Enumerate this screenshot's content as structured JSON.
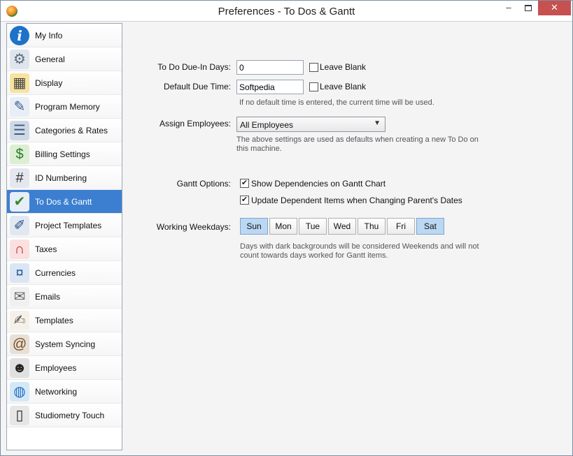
{
  "window": {
    "title": "Preferences - To Dos & Gantt",
    "minimize_symbol": "–",
    "close_symbol": "✕"
  },
  "sidebar": {
    "items": [
      {
        "label": "My Info",
        "icon": "info-icon",
        "glyph": "i",
        "bg": "#1e72c9",
        "fg": "#ffffff"
      },
      {
        "label": "General",
        "icon": "gear-icon",
        "glyph": "⚙",
        "bg": "#dfe5ec",
        "fg": "#5a6a7e"
      },
      {
        "label": "Display",
        "icon": "monitor-icon",
        "glyph": "▦",
        "bg": "#f7e3a0",
        "fg": "#444444"
      },
      {
        "label": "Program Memory",
        "icon": "memory-pencil-icon",
        "glyph": "✎",
        "bg": "#e7eef6",
        "fg": "#3a5a8a"
      },
      {
        "label": "Categories & Rates",
        "icon": "categories-icon",
        "glyph": "☰",
        "bg": "#cfd9e6",
        "fg": "#3c5b85"
      },
      {
        "label": "Billing Settings",
        "icon": "billing-dollar-icon",
        "glyph": "$",
        "bg": "#dcefd4",
        "fg": "#2b7a2b"
      },
      {
        "label": "ID Numbering",
        "icon": "id-numbering-icon",
        "glyph": "#",
        "bg": "#e4e8ee",
        "fg": "#333333"
      },
      {
        "label": "To Dos & Gantt",
        "icon": "todo-gantt-icon",
        "glyph": "✔",
        "bg": "#e8eef8",
        "fg": "#3a8a2a"
      },
      {
        "label": "Project Templates",
        "icon": "project-templates-icon",
        "glyph": "✐",
        "bg": "#e2e8f2",
        "fg": "#2a4d80"
      },
      {
        "label": "Taxes",
        "icon": "tax-magnet-icon",
        "glyph": "∩",
        "bg": "#fbe0e0",
        "fg": "#c02020"
      },
      {
        "label": "Currencies",
        "icon": "currency-icon",
        "glyph": "¤",
        "bg": "#dbe6f4",
        "fg": "#2a5a9a"
      },
      {
        "label": "Emails",
        "icon": "email-icon",
        "glyph": "✉",
        "bg": "#f0f0f0",
        "fg": "#666666"
      },
      {
        "label": "Templates",
        "icon": "templates-icon",
        "glyph": "✍",
        "bg": "#f5f1e8",
        "fg": "#555555"
      },
      {
        "label": "System Syncing",
        "icon": "sync-icon",
        "glyph": "@",
        "bg": "#e6e0d6",
        "fg": "#7a4a20"
      },
      {
        "label": "Employees",
        "icon": "employees-icon",
        "glyph": "☻",
        "bg": "#e0e0e0",
        "fg": "#222222"
      },
      {
        "label": "Networking",
        "icon": "globe-icon",
        "glyph": "◍",
        "bg": "#d5e8f7",
        "fg": "#1c6cc0"
      },
      {
        "label": "Studiometry Touch",
        "icon": "phone-icon",
        "glyph": "▯",
        "bg": "#e6e6e6",
        "fg": "#222222"
      }
    ]
  },
  "todo": {
    "due_days_label": "To Do Due-In Days:",
    "due_days_value": "0",
    "due_days_blank_label": "Leave Blank",
    "due_time_label": "Default Due Time:",
    "due_time_value": "Softpedia",
    "due_time_blank_label": "Leave Blank",
    "due_time_hint": "If no default time is entered, the current time will be used.",
    "assign_label": "Assign Employees:",
    "assign_value": "All Employees",
    "assign_hint_1": "The above settings are used as defaults when creating a new To Do on",
    "assign_hint_2": "this machine."
  },
  "gantt": {
    "options_label": "Gantt Options:",
    "show_dependencies_label": "Show Dependencies on Gantt Chart",
    "show_dependencies_checked": "✔",
    "update_dependent_label": "Update Dependent Items when Changing Parent's Dates",
    "update_dependent_checked": "✔",
    "weekdays_label": "Working Weekdays:",
    "days": [
      "Sun",
      "Mon",
      "Tue",
      "Wed",
      "Thu",
      "Fri",
      "Sat"
    ],
    "weekend_hint_1": "Days with dark backgrounds will be considered Weekends and will not",
    "weekend_hint_2": "count towards days worked for Gantt items."
  }
}
